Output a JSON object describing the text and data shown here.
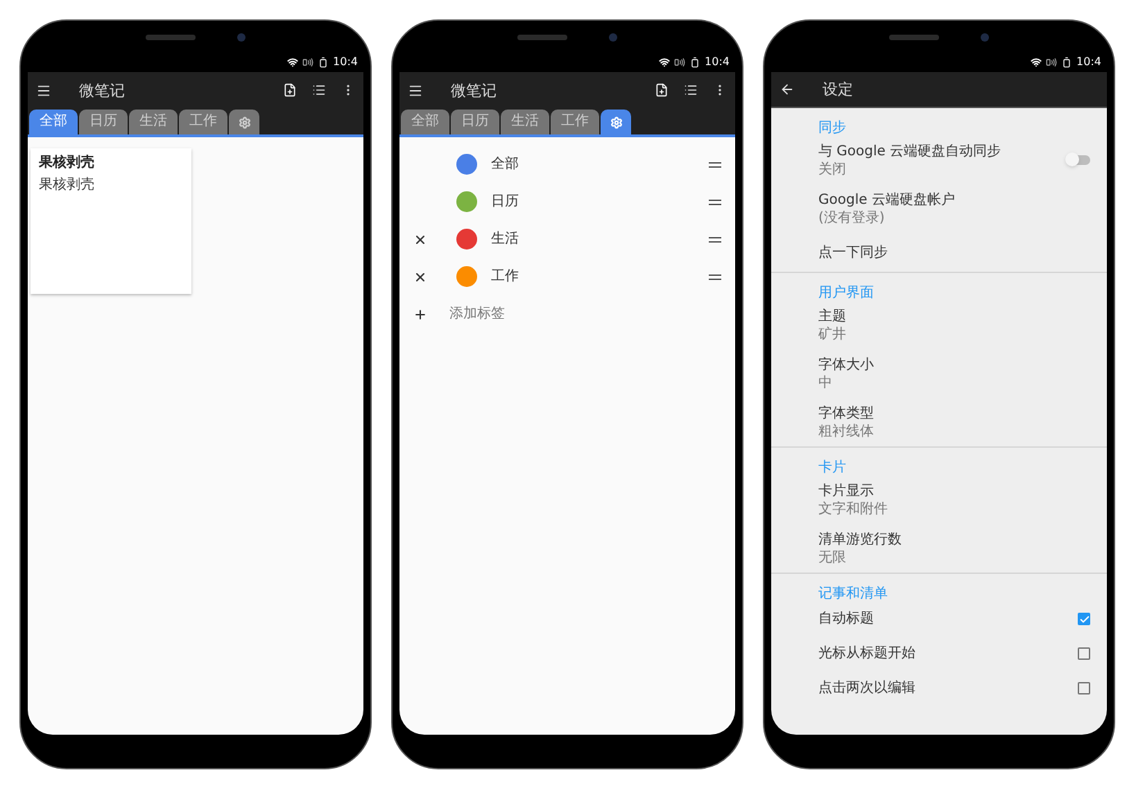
{
  "phones": [
    {
      "kind": "notes",
      "status_time": "10:4",
      "app_bar": {
        "title": "微笔记"
      },
      "tabs": [
        {
          "kind": "label",
          "label": "全部",
          "selected": true
        },
        {
          "kind": "label",
          "label": "日历",
          "selected": false
        },
        {
          "kind": "label",
          "label": "生活",
          "selected": false
        },
        {
          "kind": "label",
          "label": "工作",
          "selected": false
        },
        {
          "kind": "gear",
          "selected": false
        }
      ],
      "cards": [
        {
          "title": "果核剥壳",
          "body": "果核剥壳"
        }
      ]
    },
    {
      "kind": "labels",
      "status_time": "10:4",
      "app_bar": {
        "title": "微笔记"
      },
      "tabs": [
        {
          "kind": "label",
          "label": "全部",
          "selected": false
        },
        {
          "kind": "label",
          "label": "日历",
          "selected": false
        },
        {
          "kind": "label",
          "label": "生活",
          "selected": false
        },
        {
          "kind": "label",
          "label": "工作",
          "selected": false
        },
        {
          "kind": "gear",
          "selected": true
        }
      ],
      "labels": [
        {
          "name": "全部",
          "color": "#4a7fe6",
          "removable": false
        },
        {
          "name": "日历",
          "color": "#7cb342",
          "removable": false
        },
        {
          "name": "生活",
          "color": "#e53935",
          "removable": true
        },
        {
          "name": "工作",
          "color": "#fb8c00",
          "removable": true
        }
      ],
      "add_label": "添加标签"
    },
    {
      "kind": "settings",
      "status_time": "10:4",
      "app_bar": {
        "title": "设定"
      },
      "sections": [
        {
          "header": "同步",
          "items": [
            {
              "kind": "switch",
              "title": "与 Google 云端硬盘自动同步",
              "subtitle": "关闭",
              "on": false
            },
            {
              "kind": "text",
              "title": "Google 云端硬盘帐户",
              "subtitle": "(没有登录)"
            },
            {
              "kind": "text",
              "title": "点一下同步"
            }
          ]
        },
        {
          "header": "用户界面",
          "items": [
            {
              "kind": "text",
              "title": "主题",
              "subtitle": "矿井"
            },
            {
              "kind": "text",
              "title": "字体大小",
              "subtitle": "中"
            },
            {
              "kind": "text",
              "title": "字体类型",
              "subtitle": "粗衬线体"
            }
          ]
        },
        {
          "header": "卡片",
          "items": [
            {
              "kind": "text",
              "title": "卡片显示",
              "subtitle": "文字和附件"
            },
            {
              "kind": "text",
              "title": "清单游览行数",
              "subtitle": "无限"
            }
          ]
        },
        {
          "header": "记事和清单",
          "items": [
            {
              "kind": "checkbox",
              "title": "自动标题",
              "checked": true
            },
            {
              "kind": "checkbox",
              "title": "光标从标题开始",
              "checked": false
            },
            {
              "kind": "checkbox",
              "title": "点击两次以编辑",
              "checked": false
            }
          ]
        }
      ]
    }
  ]
}
